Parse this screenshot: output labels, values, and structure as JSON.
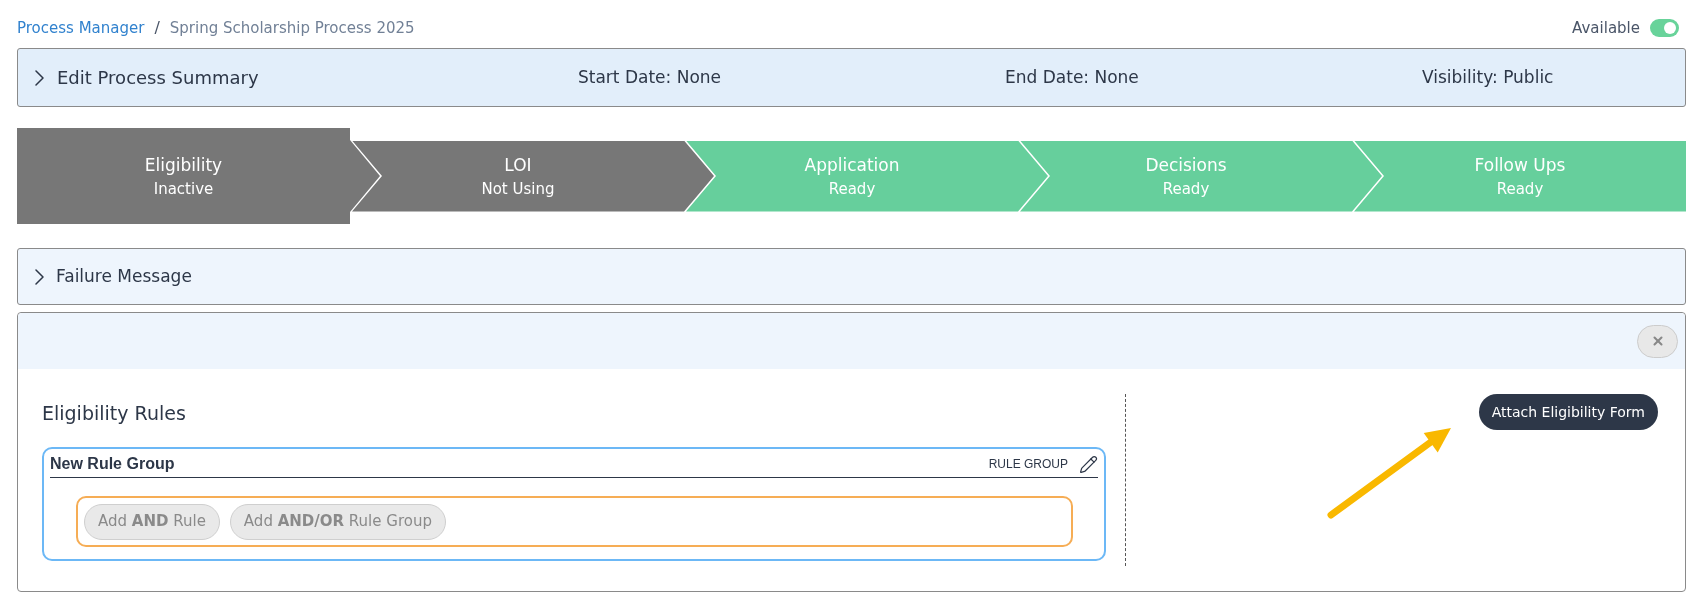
{
  "breadcrumb": {
    "parent": "Process Manager",
    "separator": "/",
    "current": "Spring Scholarship Process 2025"
  },
  "availability": {
    "label": "Available",
    "on": true
  },
  "summary": {
    "title": "Edit Process Summary",
    "expanded": false,
    "fields": [
      "Start Date: None",
      "End Date: None",
      "Visibility: Public"
    ]
  },
  "steps": [
    {
      "title": "Eligibility",
      "status": "Inactive",
      "ready": false,
      "selected": true
    },
    {
      "title": "LOI",
      "status": "Not Using",
      "ready": false,
      "selected": false
    },
    {
      "title": "Application",
      "status": "Ready",
      "ready": true,
      "selected": false
    },
    {
      "title": "Decisions",
      "status": "Ready",
      "ready": true,
      "selected": false
    },
    {
      "title": "Follow Ups",
      "status": "Ready",
      "ready": true,
      "selected": false
    }
  ],
  "failure_message": {
    "title": "Failure Message",
    "expanded": false
  },
  "eligibility": {
    "heading": "Eligibility Rules",
    "rule_group": {
      "name": "New Rule Group",
      "type_label": "RULE GROUP",
      "buttons": [
        "Add **AND** Rule",
        "Add **AND/OR** Rule Group"
      ]
    },
    "attach_button": "Attach Eligibility Form"
  }
}
